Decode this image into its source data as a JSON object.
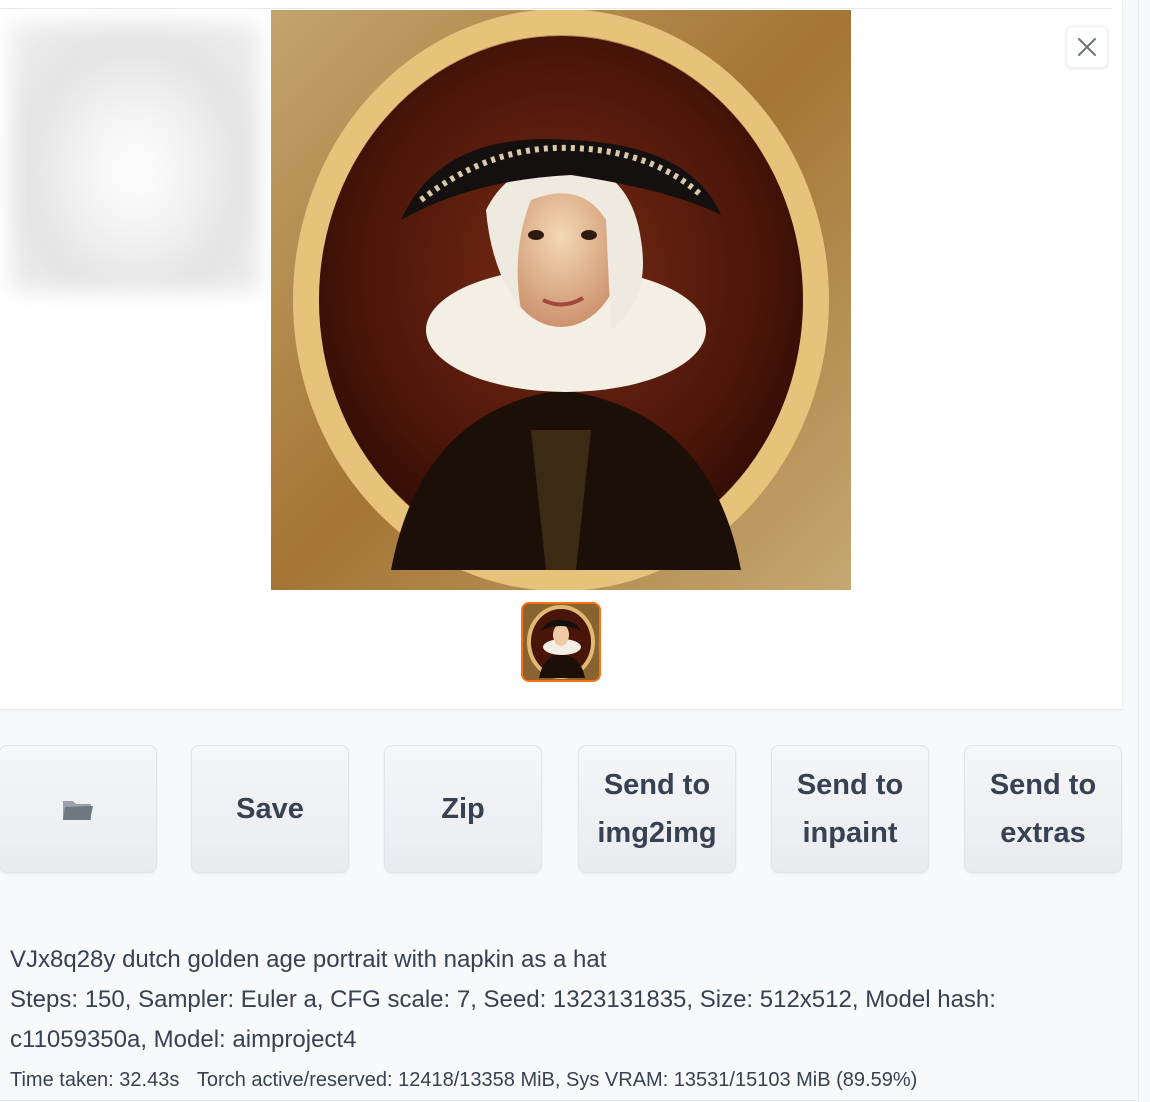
{
  "gallery": {
    "close_icon": "close-icon",
    "selected_index": 1
  },
  "buttons": {
    "open_folder_icon": "folder-icon",
    "save_label": "Save",
    "zip_label": "Zip",
    "send_img2img_label": "Send to\nimg2img",
    "send_inpaint_label": "Send to\ninpaint",
    "send_extras_label": "Send to\nextras"
  },
  "generation_info": {
    "prompt": "VJx8q28y dutch golden age portrait with napkin as a hat",
    "params": "Steps: 150, Sampler: Euler a, CFG scale: 7, Seed: 1323131835, Size: 512x512, Model hash: c11059350a, Model: aimproject4"
  },
  "performance": {
    "time_taken": "Time taken: 32.43s",
    "memory": "Torch active/reserved: 12418/13358 MiB, Sys VRAM: 13531/15103 MiB (89.59%)"
  },
  "colors": {
    "accent": "#f97316",
    "button_bg": "#eceef2",
    "text": "#374151"
  }
}
